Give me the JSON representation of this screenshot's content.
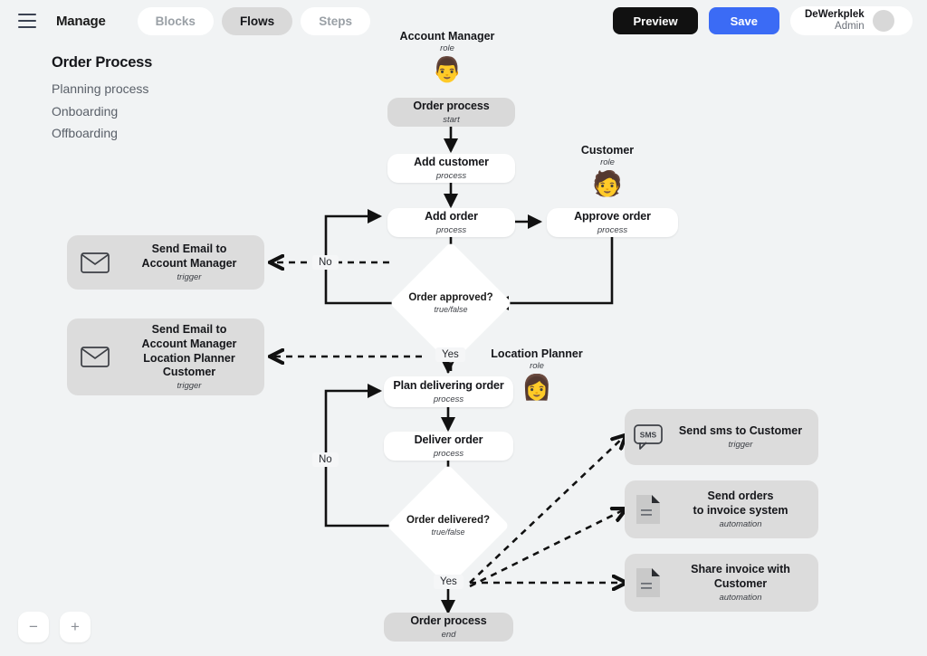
{
  "header": {
    "menu_icon": "hamburger-icon",
    "brand": "Manage",
    "tabs": [
      {
        "label": "Blocks",
        "active": false
      },
      {
        "label": "Flows",
        "active": true
      },
      {
        "label": "Steps",
        "active": false
      }
    ],
    "preview_label": "Preview",
    "save_label": "Save",
    "account_name": "DeWerkplek",
    "account_role": "Admin",
    "colors": {
      "save_bg": "#3b6bf5",
      "preview_bg": "#111111",
      "active_tab_bg": "#d9d9d9"
    }
  },
  "sidebar": {
    "title": "Order Process",
    "items": [
      {
        "label": "Planning process"
      },
      {
        "label": "Onboarding"
      },
      {
        "label": "Offboarding"
      }
    ]
  },
  "roles": [
    {
      "name": "Account Manager",
      "sub": "role",
      "avatar": "👨"
    },
    {
      "name": "Customer",
      "sub": "role",
      "avatar": "🧑"
    },
    {
      "name": "Location Planner",
      "sub": "role",
      "avatar": "👩"
    }
  ],
  "nodes": [
    {
      "title": "Order process",
      "sub": "start"
    },
    {
      "title": "Add customer",
      "sub": "process"
    },
    {
      "title": "Add order",
      "sub": "process"
    },
    {
      "title": "Approve order",
      "sub": "process"
    },
    {
      "title": "Plan delivering order",
      "sub": "process"
    },
    {
      "title": "Deliver order",
      "sub": "process"
    },
    {
      "title": "Order process",
      "sub": "end"
    }
  ],
  "decisions": [
    {
      "title": "Order approved?",
      "sub": "true/false"
    },
    {
      "title": "Order delivered?",
      "sub": "true/false"
    }
  ],
  "edge_labels": [
    {
      "text": "No"
    },
    {
      "text": "Yes"
    },
    {
      "text": "No"
    },
    {
      "text": "Yes"
    }
  ],
  "cards": [
    {
      "title": "Send Email to\nAccount Manager",
      "lines": [
        "Send Email to",
        "Account Manager"
      ],
      "sub": "trigger",
      "icon": "envelope-icon"
    },
    {
      "title": "Send Email to Account Manager Location Planner Customer",
      "lines": [
        "Send Email to",
        "Account Manager",
        "Location Planner",
        "Customer"
      ],
      "sub": "trigger",
      "icon": "envelope-icon"
    },
    {
      "title": "Send sms to Customer",
      "lines": [
        "Send sms to Customer"
      ],
      "sub": "trigger",
      "icon": "sms-bubble-icon",
      "icon_text": "SMS"
    },
    {
      "title": "Send orders to invoice system",
      "lines": [
        "Send orders",
        "to invoice system"
      ],
      "sub": "automation",
      "icon": "document-icon"
    },
    {
      "title": "Share invoice with Customer",
      "lines": [
        "Share invoice with",
        "Customer"
      ],
      "sub": "automation",
      "icon": "document-icon"
    }
  ],
  "zoom_controls": {
    "out_label": "−",
    "in_label": "+"
  }
}
